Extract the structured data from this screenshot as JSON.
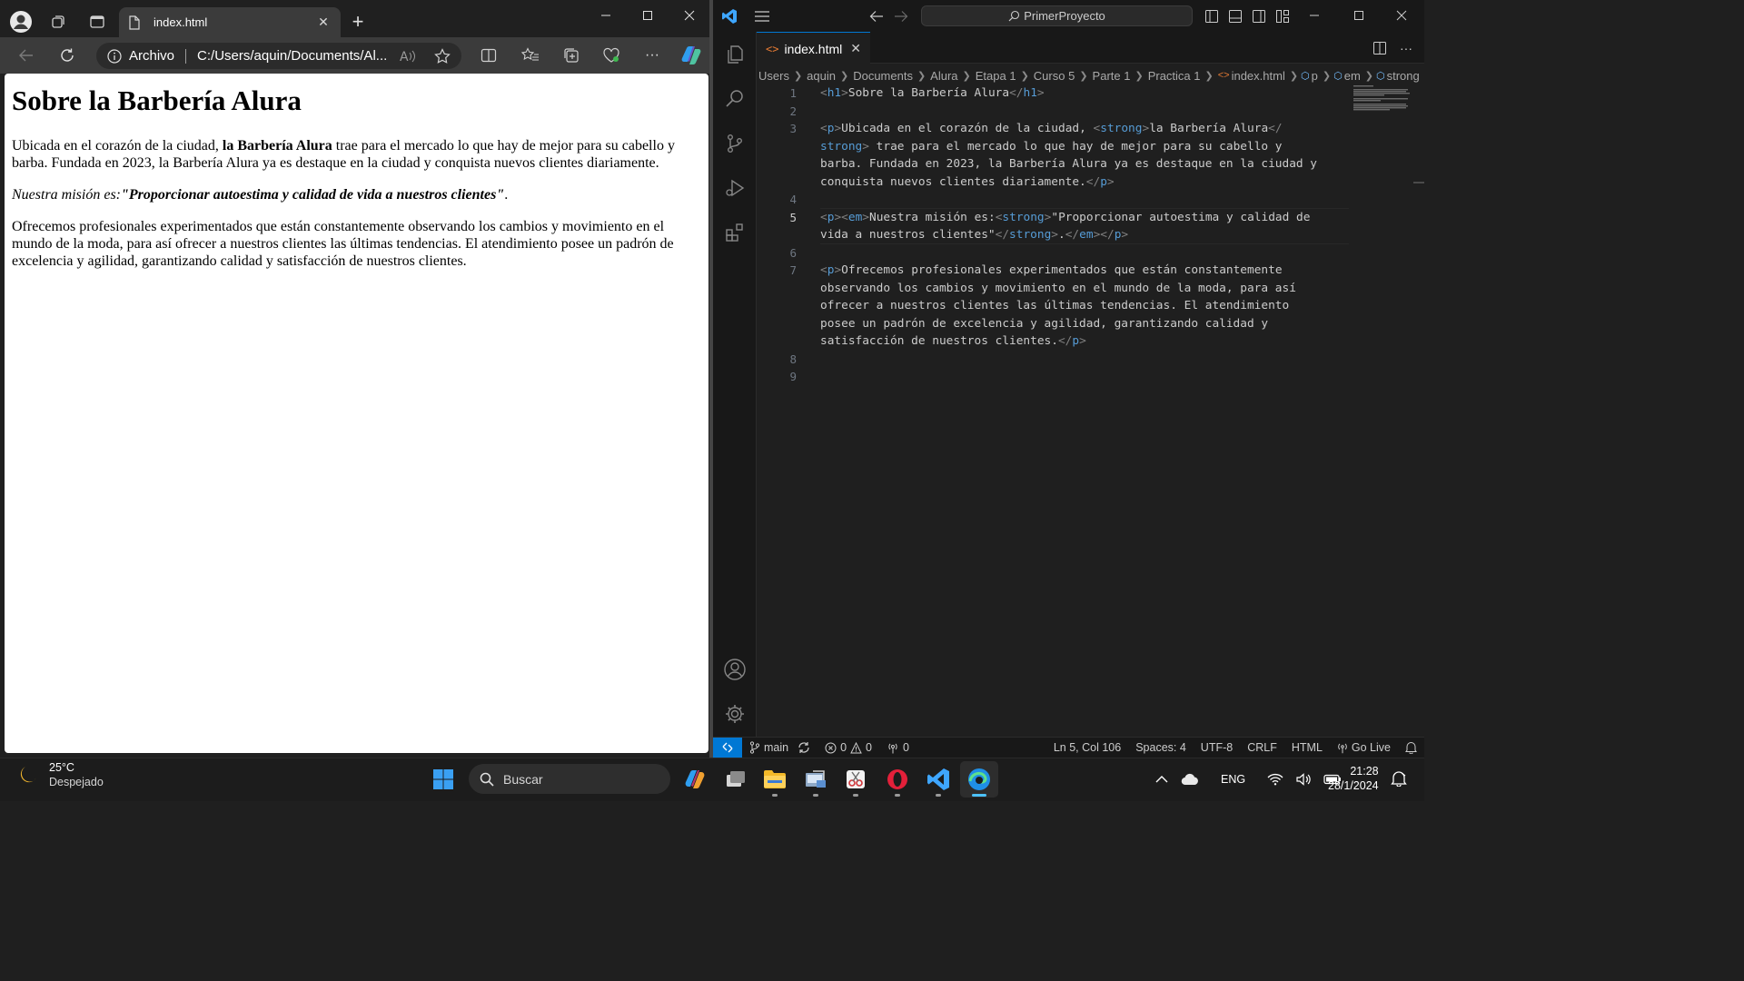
{
  "browser": {
    "tab_title": "index.html",
    "address": {
      "scheme_label": "Archivo",
      "url": "C:/Users/aquin/Documents/Al..."
    },
    "page": {
      "heading": "Sobre la Barbería Alura",
      "p1_before": "Ubicada en el corazón de la ciudad, ",
      "p1_strong": "la Barbería Alura",
      "p1_after": " trae para el mercado lo que hay de mejor para su cabello y barba. Fundada en 2023, la Barbería Alura ya es destaque en la ciudad y conquista nuevos clientes diariamente.",
      "p2_em": "Nuestra misión es:",
      "p2_strong": "\"Proporcionar autoestima y calidad de vida a nuestros clientes\"",
      "p2_end": ".",
      "p3": "Ofrecemos profesionales experimentados que están constantemente observando los cambios y movimiento en el mundo de la moda, para así ofrecer a nuestros clientes las últimas tendencias. El atendimiento posee un padrón de excelencia y agilidad, garantizando calidad y satisfacción de nuestros clientes."
    }
  },
  "vscode": {
    "search_label": "PrimerProyecto",
    "tab_label": "index.html",
    "breadcrumb": [
      "Users",
      "aquin",
      "Documents",
      "Alura",
      "Etapa 1",
      "Curso 5",
      "Parte 1",
      "Practica 1",
      "index.html",
      "p",
      "em",
      "strong"
    ],
    "line_numbers": [
      "1",
      "2",
      "3",
      "4",
      "5",
      "6",
      "7",
      "8",
      "9"
    ],
    "code": {
      "l1_text": "Sobre la Barbería Alura",
      "l3a_text": "Ubicada en el corazón de la ciudad, ",
      "l3a_strong": "la Barbería Alura",
      "l3b_rest": " trae para el mercado lo que hay de mejor para su cabello y",
      "l3c": "barba. Fundada en 2023, la Barbería Alura ya es destaque en la ciudad y",
      "l3d_text": "conquista nuevos clientes diariamente.",
      "l5a_text": "Nuestra misión es:",
      "l5a_strong": "\"Proporcionar autoestima y calidad de",
      "l5b_text": "vida a nuestros clientes\"",
      "l5b_dot": ".",
      "l7a_text": "Ofrecemos profesionales experimentados que están constantemente",
      "l7b": "observando los cambios y movimiento en el mundo de la moda, para así",
      "l7c": "ofrecer a nuestros clientes las últimas tendencias. El atendimiento",
      "l7d": "posee un padrón de excelencia y agilidad, garantizando calidad y",
      "l7e_text": "satisfacción de nuestros clientes."
    },
    "status": {
      "branch": "main",
      "errors": "0",
      "warnings": "0",
      "ports": "0",
      "position": "Ln 5, Col 106",
      "spaces": "Spaces: 4",
      "encoding": "UTF-8",
      "eol": "CRLF",
      "language": "HTML",
      "golive": "Go Live"
    }
  },
  "taskbar": {
    "temperature": "25°C",
    "weather": "Despejado",
    "search_placeholder": "Buscar",
    "language": "ENG",
    "time": "21:28",
    "date": "28/1/2024"
  },
  "colors": {
    "vscode_accent": "#0078d4",
    "tag_name": "#569cd6",
    "tag_bracket": "#808080",
    "taskbar_active": "#4cc2ff"
  }
}
